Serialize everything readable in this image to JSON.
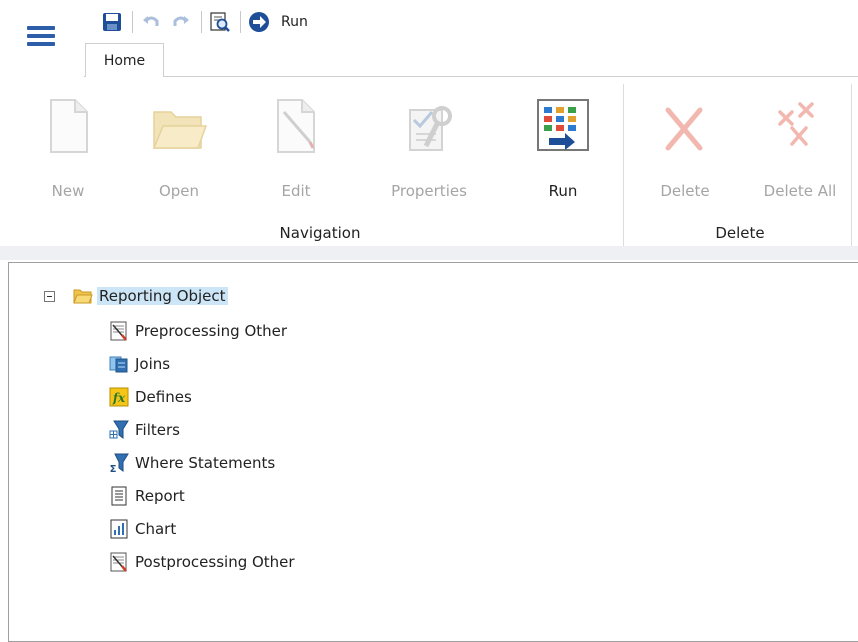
{
  "quick_access": {
    "run_label": "Run",
    "icons": [
      "save-icon",
      "undo-icon",
      "redo-icon",
      "preview-icon",
      "run-icon"
    ]
  },
  "tabs": [
    {
      "label": "Home"
    }
  ],
  "ribbon": {
    "navigation": {
      "label": "Navigation",
      "buttons": [
        {
          "label": "New",
          "enabled": false
        },
        {
          "label": "Open",
          "enabled": false
        },
        {
          "label": "Edit",
          "enabled": false
        },
        {
          "label": "Properties",
          "enabled": false
        },
        {
          "label": "Run",
          "enabled": true
        }
      ]
    },
    "delete": {
      "label": "Delete",
      "buttons": [
        {
          "label": "Delete",
          "enabled": false
        },
        {
          "label": "Delete All",
          "enabled": false
        }
      ]
    }
  },
  "tree": {
    "root": {
      "label": "Reporting Object",
      "expanded": true,
      "selected": true
    },
    "children": [
      {
        "label": "Preprocessing Other",
        "icon": "procedure-icon"
      },
      {
        "label": "Joins",
        "icon": "joins-icon"
      },
      {
        "label": "Defines",
        "icon": "defines-icon"
      },
      {
        "label": "Filters",
        "icon": "filter-icon"
      },
      {
        "label": "Where Statements",
        "icon": "where-filter-icon"
      },
      {
        "label": "Report",
        "icon": "report-icon"
      },
      {
        "label": "Chart",
        "icon": "chart-icon"
      },
      {
        "label": "Postprocessing Other",
        "icon": "procedure-icon"
      }
    ]
  },
  "colors": {
    "accent": "#2d5ea8",
    "selection": "#cde6f7",
    "disabled_text": "#a5a5a5"
  }
}
